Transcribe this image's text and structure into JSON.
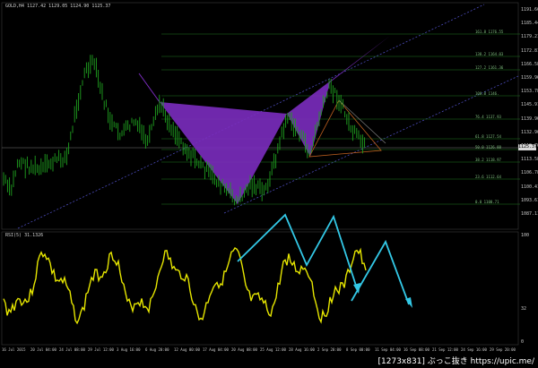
{
  "chart": {
    "symbol_header": "GOLD,H4  1127.42 1129.05 1124.90 1125.37",
    "indicator_header": "RSI(5) 31.1326",
    "price_labels": [
      "1191.66",
      "1185.44",
      "1179.21",
      "1172.81",
      "1166.58",
      "1159.96",
      "1153.78",
      "1145.91",
      "1139.96",
      "1132.96",
      "1119.76",
      "1113.58",
      "1106.78",
      "1100.41",
      "1093.61",
      "1087.11"
    ],
    "current_price": "1125.37",
    "rsi_levels": [
      "100",
      "32",
      "0"
    ],
    "fib_levels": [
      "161.8 1176.55",
      "138.2 1164.03",
      "127.2 1161.36",
      "100.0 1146.",
      "76.4 1137.93",
      "61.8 1127.54",
      "50.0 1126.88",
      "38.2 1118.97",
      "23.6 1112.64",
      "0.0 1100.71"
    ],
    "time_labels": [
      "16 Jul 2015",
      "20 Jul 04:00",
      "24 Jul 08:00",
      "29 Jul 12:00",
      "3 Aug 16:00",
      "6 Aug 20:00",
      "12 Aug 00:00",
      "17 Aug 04:00",
      "20 Aug 08:00",
      "25 Aug 12:00",
      "28 Aug 16:00",
      "2 Sep 20:00",
      "8 Sep 00:00",
      "11 Sep 04:00",
      "16 Sep 08:00",
      "21 Sep 12:00",
      "24 Sep 16:00",
      "29 Sep 20:00"
    ],
    "colors": {
      "candles": "#1fa01f",
      "pattern": "#7b2cbf",
      "rsi": "#e6e600",
      "arrows": "#33c8e6",
      "fib": "#1f7a1f",
      "channel": "#4a4ab8",
      "triangle": "#c0601f"
    }
  },
  "watermark": "[1273x831] ぶっこ抜き https://upic.me/"
}
